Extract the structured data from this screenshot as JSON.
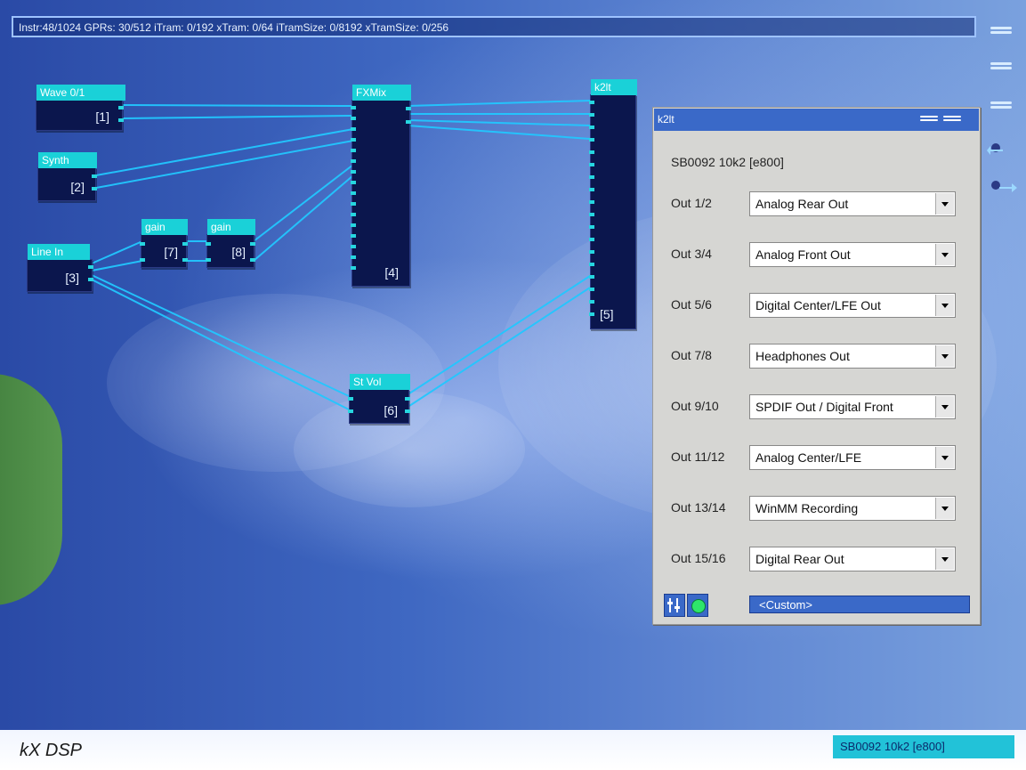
{
  "top_status": {
    "text": "Instr:48/1024 GPRs: 30/512 iTram: 0/192 xTram: 0/64 iTramSize: 0/8192 xTramSize: 0/256"
  },
  "nodes": [
    {
      "title": "Wave 0/1",
      "id": "[1]"
    },
    {
      "title": "Synth",
      "id": "[2]"
    },
    {
      "title": "Line In",
      "id": "[3]"
    },
    {
      "title": "FXMix",
      "id": "[4]"
    },
    {
      "title": "k2lt",
      "id": "[5]"
    },
    {
      "title": "St Vol",
      "id": "[6]"
    },
    {
      "title": "gain",
      "id": "[7]"
    },
    {
      "title": "gain",
      "id": "[8]"
    }
  ],
  "dialog": {
    "title": "k2lt",
    "device": "SB0092 10k2 [e800]",
    "outputs": [
      {
        "label": "Out 1/2",
        "value": "Analog Rear Out"
      },
      {
        "label": "Out 3/4",
        "value": "Analog Front Out"
      },
      {
        "label": "Out 5/6",
        "value": "Digital Center/LFE Out"
      },
      {
        "label": "Out 7/8",
        "value": "Headphones Out"
      },
      {
        "label": "Out 9/10",
        "value": "SPDIF Out / Digital Front"
      },
      {
        "label": "Out 11/12",
        "value": "Analog Center/LFE"
      },
      {
        "label": "Out 13/14",
        "value": "WinMM Recording"
      },
      {
        "label": "Out 15/16",
        "value": "Digital Rear Out"
      }
    ],
    "preset": "<Custom>"
  },
  "bottom": {
    "app_name": "kX DSP",
    "device_status": "SB0092 10k2 [e800]"
  },
  "colors": {
    "accent": "#1ad1d8",
    "node_bg": "#0b164d",
    "wire": "#22c7ff",
    "dialog_title": "#3a69c8"
  },
  "icons": [
    "menu-lines-icon",
    "menu-lines-icon",
    "menu-lines-icon",
    "arrow-left-icon",
    "arrow-right-icon",
    "mixer-icon",
    "power-icon",
    "dropdown-arrow-icon"
  ]
}
